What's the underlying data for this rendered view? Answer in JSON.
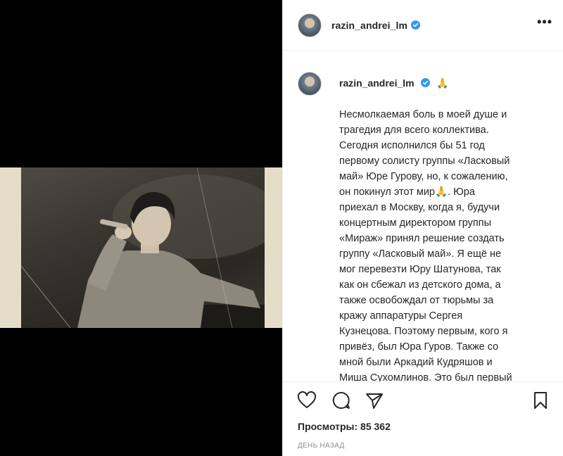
{
  "post": {
    "username": "razin_andrei_lm",
    "more_icon": "•••",
    "comment_username": "razin_andrei_lm",
    "pray_emoji": "🙏",
    "caption": "Несмолкаемая боль в моей душе и\nтрагедия для всего коллектива.\nСегодня исполнился бы 51 год\nпервому солисту группы «Ласковый\nмай» Юре Гурову, но, к сожалению,\nон покинул этот мир🙏. Юра\nприехал в Москву, когда я, будучи\nконцертным директором группы\n«Мираж» принял решение создать\nгруппу «Ласковый май». Я ещё не\nмог перевезти Юру Шатунова, так\nкак он сбежал из детского дома, а\nтакже освобождал от тюрьмы за\nкражу аппаратуры Сергея\nКузнецова. Поэтому первым, кого я\nпривёз, был Юра Гуров. Также со\nмной были Аркадий Кудряшов и\nМиша Сухомлинов. Это был первый",
    "views_label": "Просмотры: 85 362",
    "date_label": "ДЕНЬ НАЗАД"
  },
  "icons": {
    "verified": "verified-badge-icon",
    "like": "heart-icon",
    "comment": "comment-bubble-icon",
    "share": "paper-plane-icon",
    "save": "bookmark-icon"
  },
  "colors": {
    "verified": "#3897f0",
    "text": "#262626",
    "muted": "#8e8e8e",
    "border": "#efefef"
  }
}
